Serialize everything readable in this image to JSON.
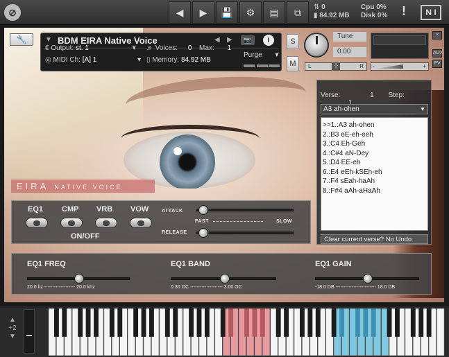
{
  "topbar": {
    "logo": "⊘",
    "nav_left": "◀",
    "nav_right": "▶",
    "icons": [
      "save-icon",
      "gear-icon",
      "view-icon",
      "resize-icon"
    ],
    "midi": "0",
    "memory": "84.92 MB",
    "cpu_label": "Cpu",
    "cpu_value": "0%",
    "disk_label": "Disk",
    "disk_value": "0%",
    "warn": "!",
    "ni": "N I"
  },
  "header": {
    "title": "BDM EIRA Native Voice",
    "output_label": "Output:",
    "output_value": "st. 1",
    "midi_label": "MIDI Ch:",
    "midi_value": "[A]  1",
    "voices_label": "Voices:",
    "voices_value": "0",
    "max_label": "Max:",
    "max_value": "1",
    "memory_label": "Memory:",
    "memory_value": "84.92 MB",
    "purge": "Purge"
  },
  "buttons": {
    "solo": "S",
    "mute": "M"
  },
  "tune": {
    "label": "Tune",
    "value": "0.00",
    "pan_l": "L",
    "pan_r": "R",
    "pan_c": "·|·"
  },
  "volume": {
    "minus": "-",
    "plus": "+"
  },
  "side": [
    "×",
    "AUX",
    "PV"
  ],
  "verse": {
    "verse_label": "Verse:",
    "verse_value": "1",
    "step_label": "Step:",
    "step_value": "1",
    "selected": "A3 ah-ohen",
    "items": [
      ">>1.:A3 ah-ohen",
      "2.:B3 eE-eh-eeh",
      "3.:C4 Eh-Geh",
      "4.:C#4 aN-Dey",
      "5.:D4 EE-eh",
      "6.:E4 eEh-kSEh-eh",
      "7.:F4 sEah-haAh",
      "8.:F#4 aAh-aHaAh"
    ],
    "clear": "Clear current verse? No Undo"
  },
  "banner": {
    "main": "EIRA",
    "sub": "NATIVE VOICE"
  },
  "fx": {
    "eq1": "EQ1",
    "cmp": "CMP",
    "vrb": "VRB",
    "vow": "VOW",
    "onoff": "ON/OFF",
    "attack": "ATTACK",
    "release": "RELEASE",
    "fast": "FAST",
    "slow": "SLOW"
  },
  "eq": {
    "freq_label": "EQ1 FREQ",
    "freq_min": "20.0 hz",
    "freq_max": "20.0 khz",
    "band_label": "EQ1 BAND",
    "band_min": "0.30 OC",
    "band_max": "3.00 OC",
    "gain_label": "EQ1 GAIN",
    "gain_min": "-18.0 DB",
    "gain_max": "18.0 DB"
  },
  "keyboard": {
    "octave": "+2",
    "pink_highlight": "#e89a9e",
    "blue_highlight": "#7ec8e0"
  }
}
